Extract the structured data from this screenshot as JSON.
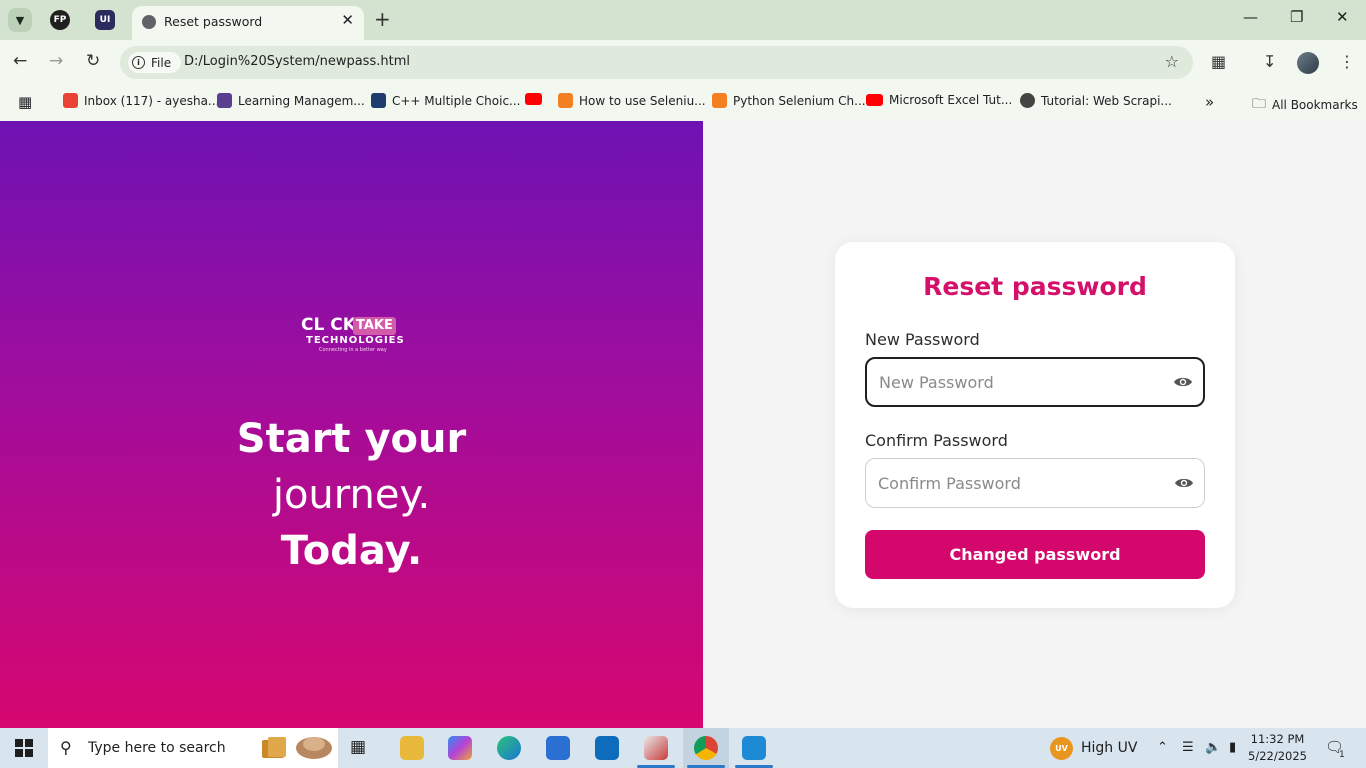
{
  "browser": {
    "tab_title": "Reset password",
    "pinned_tabs": [
      "FP",
      "UI"
    ],
    "url_chip": "File",
    "url": "D:/Login%20System/newpass.html",
    "bookmarks": [
      {
        "label": "Inbox (117) - ayesha...",
        "color": "#ea4335"
      },
      {
        "label": "Learning Managem...",
        "color": "#5a3e8f"
      },
      {
        "label": "C++ Multiple Choic...",
        "color": "#1f3c6e"
      },
      {
        "label": "",
        "color": "#ff0000"
      },
      {
        "label": "How to use Seleniu...",
        "color": "#f48024"
      },
      {
        "label": "Python Selenium Ch...",
        "color": "#f48024"
      },
      {
        "label": "Microsoft Excel Tut...",
        "color": "#ff0000"
      },
      {
        "label": "Tutorial: Web Scrapi...",
        "color": "#444444"
      }
    ],
    "all_bookmarks": "All Bookmarks"
  },
  "hero": {
    "logo_click": "CL CK",
    "logo_take": "TAKE",
    "logo_technologies": "TECHNOLOGIES",
    "logo_tagline": "Connecting in a better way",
    "line1": "Start your",
    "line2": "journey.",
    "line3": "Today."
  },
  "form": {
    "title": "Reset password",
    "new_label": "New Password",
    "new_placeholder": "New Password",
    "confirm_label": "Confirm Password",
    "confirm_placeholder": "Confirm Password",
    "submit": "Changed password",
    "accent": "#d4076d"
  },
  "taskbar": {
    "search_placeholder": "Type here to search",
    "weather": "High UV",
    "weather_badge": "UV",
    "time": "11:32 PM",
    "date": "5/22/2025",
    "notification_count": "1"
  }
}
